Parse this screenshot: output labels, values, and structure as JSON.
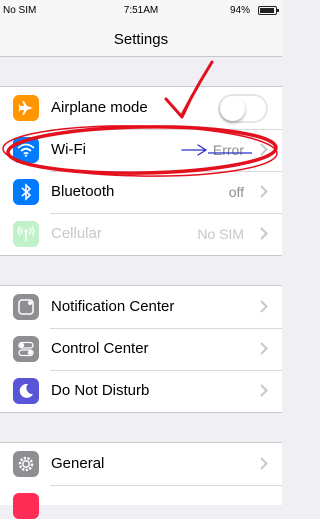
{
  "status_bar": {
    "carrier": "No SIM",
    "time": "7:51AM",
    "battery": "94%"
  },
  "nav": {
    "title": "Settings"
  },
  "groups": [
    {
      "rows": [
        {
          "label": "Airplane mode",
          "icon": "airplane-icon",
          "color": "#ff9500",
          "toggle": false
        },
        {
          "label": "Wi-Fi",
          "icon": "wifi-icon",
          "color": "#007aff",
          "value": "Error"
        },
        {
          "label": "Bluetooth",
          "icon": "bluetooth-icon",
          "color": "#007aff",
          "value": "off"
        },
        {
          "label": "Cellular",
          "icon": "cellular-icon",
          "color": "#4cd964",
          "value": "No SIM",
          "disabled": true
        }
      ]
    },
    {
      "rows": [
        {
          "label": "Notification Center",
          "icon": "notification-center-icon",
          "color": "#8e8e93"
        },
        {
          "label": "Control Center",
          "icon": "control-center-icon",
          "color": "#8e8e93"
        },
        {
          "label": "Do Not Disturb",
          "icon": "moon-icon",
          "color": "#5856d6"
        }
      ]
    },
    {
      "rows": [
        {
          "label": "General",
          "icon": "gear-icon",
          "color": "#8e8e93"
        }
      ]
    }
  ],
  "annotation": {
    "color": "#e3101d",
    "arrow_color": "#2b32c9"
  }
}
